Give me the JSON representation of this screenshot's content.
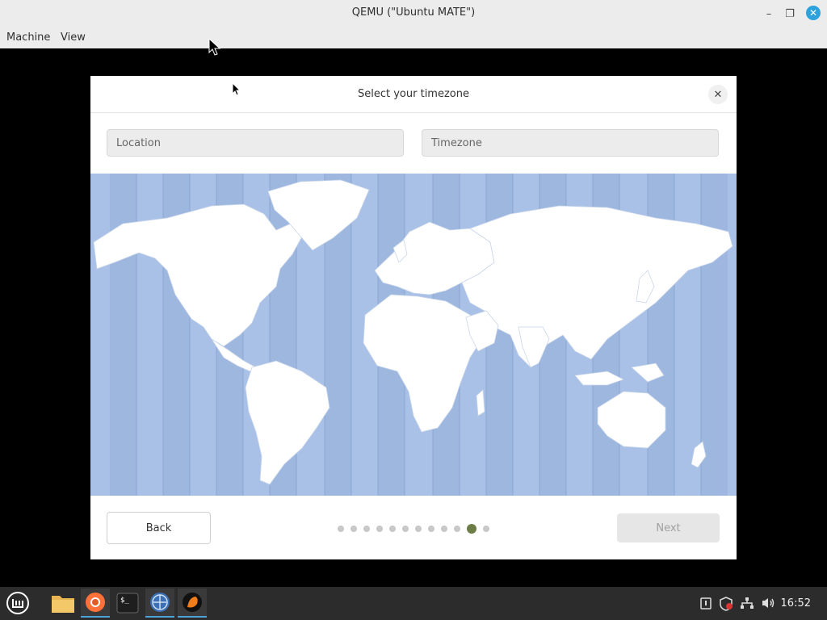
{
  "window": {
    "title": "QEMU (\"Ubuntu MATE\")",
    "controls": {
      "minimize": "–",
      "maximize": "❐",
      "close": "✕"
    }
  },
  "menubar": {
    "items": [
      "Machine",
      "View"
    ]
  },
  "dialog": {
    "title": "Select your timezone",
    "close_glyph": "✕",
    "location_placeholder": "Location",
    "timezone_placeholder": "Timezone",
    "back_label": "Back",
    "next_label": "Next",
    "progress": {
      "total_steps": 12,
      "current_step": 11
    }
  },
  "taskbar": {
    "clock": "16:52",
    "launchers": [
      "menu-icon",
      "files-icon",
      "firefox-icon",
      "terminal-icon",
      "web-icon",
      "qemu-icon"
    ],
    "tray": [
      "clipboard-icon",
      "shield-icon",
      "network-icon",
      "volume-icon"
    ]
  },
  "colors": {
    "map_water": "#a9c1e6",
    "map_land": "#ffffff",
    "accent_dot": "#6c7d45",
    "taskbar": "#2c2c2c"
  }
}
